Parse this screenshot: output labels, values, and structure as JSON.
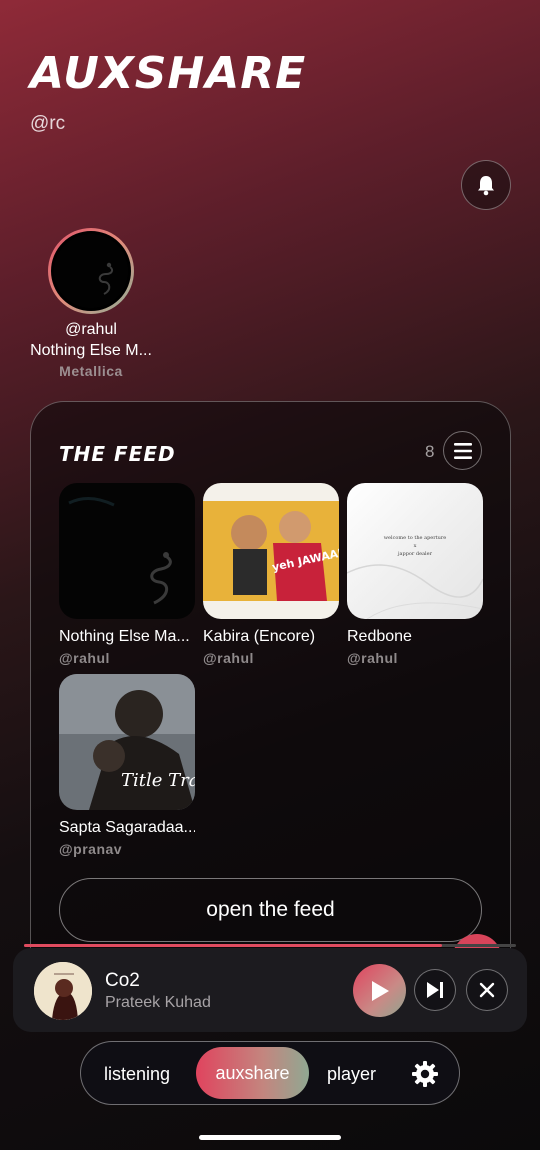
{
  "app": {
    "title": "AUXSHARE",
    "handle": "@rc"
  },
  "story": {
    "user": "@rahul",
    "song": "Nothing Else M...",
    "artist": "Metallica"
  },
  "feed": {
    "title": "THE FEED",
    "count": "8",
    "items": [
      {
        "title": "Nothing Else Ma...",
        "user": "@rahul"
      },
      {
        "title": "Kabira (Encore)",
        "user": "@rahul"
      },
      {
        "title": "Redbone",
        "user": "@rahul"
      },
      {
        "title": "Sapta Sagaradaa...",
        "user": "@pranav"
      }
    ],
    "open_label": "open the feed"
  },
  "album_text": {
    "kabira_title": "yeh JAWAANI hai DEEWANI",
    "redbone_line1": "welcome to the aperture",
    "redbone_line2": "x",
    "redbone_line3": "jappor dealer",
    "sapta_title": "Title Track"
  },
  "player": {
    "song": "Co2",
    "artist": "Prateek Kuhad",
    "progress": 0.85
  },
  "nav": {
    "items": [
      "listening",
      "auxshare",
      "player"
    ],
    "active": "auxshare"
  },
  "icons": {
    "notifications": "bell-icon",
    "feed_menu": "menu-icon",
    "play": "play-icon",
    "next": "skip-next-icon",
    "close": "close-icon",
    "settings": "gear-icon"
  },
  "colors": {
    "accent": "#e0445e",
    "accent_green": "#90a892",
    "background": "#0b0a0b"
  }
}
